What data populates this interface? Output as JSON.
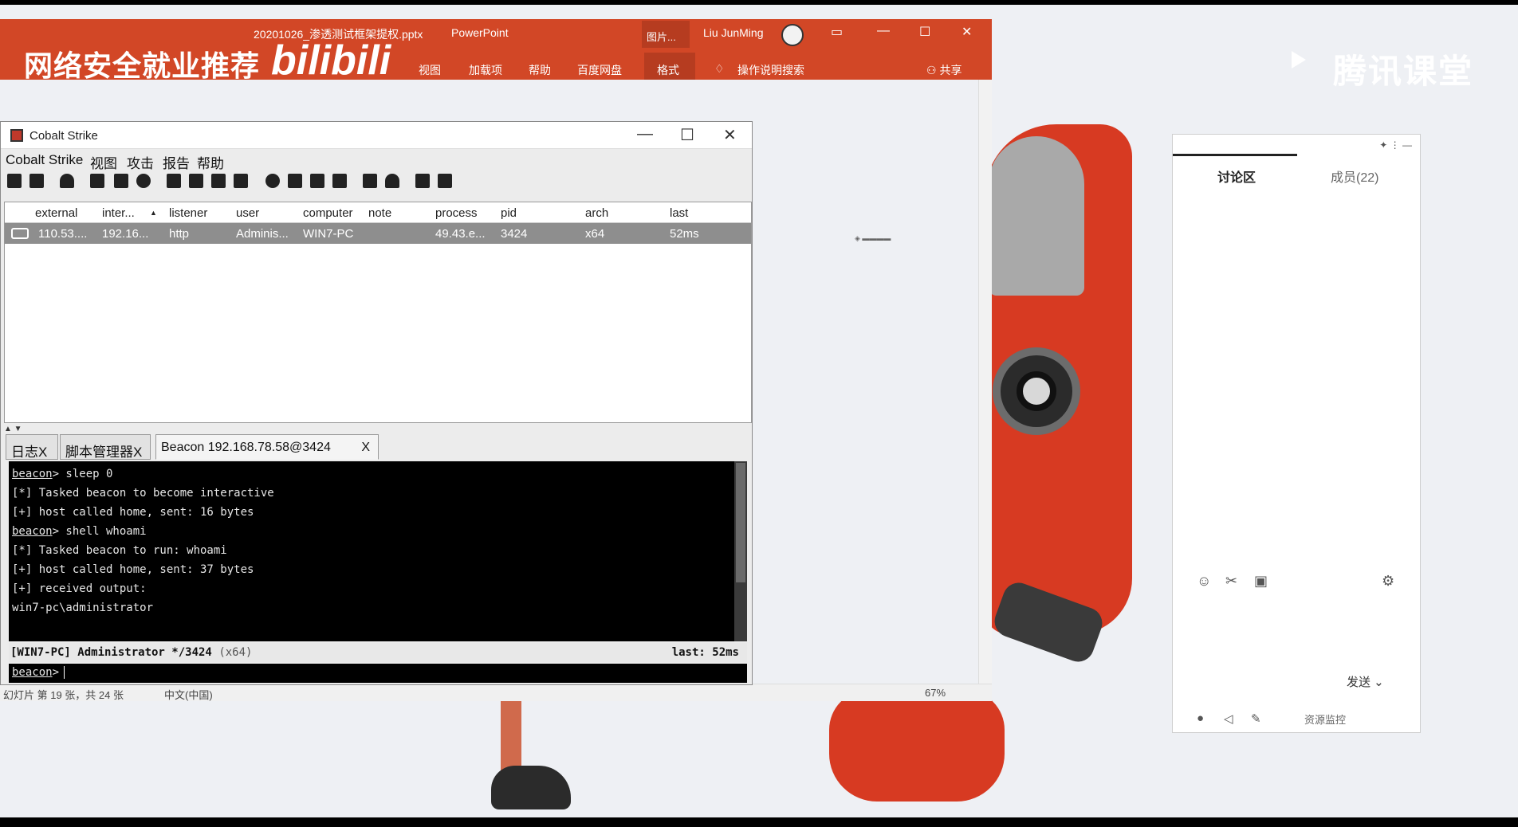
{
  "powerpoint": {
    "file_title": "20201026_渗透测试框架提权.pptx",
    "app_name": "PowerPoint",
    "pics_tab": "图片...",
    "user": "Liu JunMing",
    "ribbon": [
      "视图",
      "加载项",
      "帮助",
      "百度网盘",
      "格式",
      "操作说明搜索",
      "共享"
    ],
    "status_left": "幻灯片 第 19 张，共 24 张",
    "status_lang": "中文(中国)",
    "zoom": "67%"
  },
  "watermark": {
    "text": "网络安全就业推荐",
    "bili": "bilibili"
  },
  "tencent": {
    "logo": "腾讯课堂"
  },
  "side_panel": {
    "tab_discuss": "讨论区",
    "tab_members": "成员(22)",
    "send": "发送",
    "resource": "资源监控"
  },
  "cobalt": {
    "title": "Cobalt Strike",
    "menu": [
      "Cobalt Strike",
      "视图",
      "攻击",
      "报告",
      "帮助"
    ],
    "table": {
      "headers": [
        "external",
        "inter...",
        "listener",
        "user",
        "computer",
        "note",
        "process",
        "pid",
        "arch",
        "last"
      ],
      "rows": [
        [
          "110.53....",
          "192.16...",
          "http",
          "Adminis...",
          "WIN7-PC",
          "",
          "49.43.e...",
          "3424",
          "x64",
          "52ms"
        ]
      ]
    },
    "tabs": [
      "日志X",
      "脚本管理器X",
      "Beacon 192.168.78.58@3424",
      "X"
    ],
    "console": [
      {
        "p": "beacon",
        "t": "> sleep 0"
      },
      {
        "p": "",
        "t": "[*] Tasked beacon to become interactive"
      },
      {
        "p": "",
        "t": "[+] host called home, sent: 16 bytes"
      },
      {
        "p": "beacon",
        "t": "> shell whoami"
      },
      {
        "p": "",
        "t": "[*] Tasked beacon to run: whoami"
      },
      {
        "p": "",
        "t": "[+] host called home, sent: 37 bytes"
      },
      {
        "p": "",
        "t": "[+] received output:"
      },
      {
        "p": "",
        "t": "win7-pc\\administrator"
      }
    ],
    "status_left": "[WIN7-PC] Administrator */3424",
    "status_arch": "(x64)",
    "status_right": "last: 52ms",
    "prompt": "beacon",
    "prompt_suffix": ">"
  }
}
